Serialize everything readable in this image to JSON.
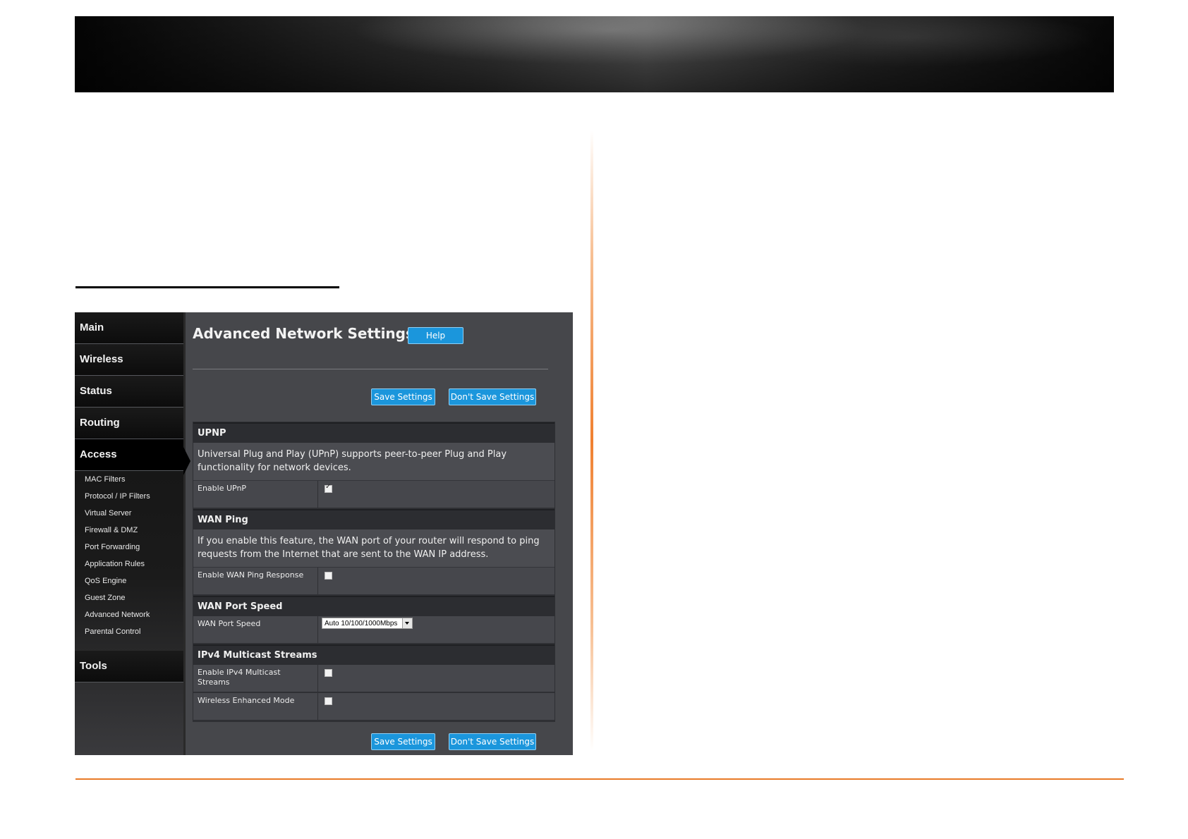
{
  "router_ui": {
    "sidebar": {
      "items": [
        {
          "label": "Main"
        },
        {
          "label": "Wireless"
        },
        {
          "label": "Status"
        },
        {
          "label": "Routing"
        },
        {
          "label": "Access"
        },
        {
          "label": "Tools"
        }
      ],
      "access_submenu": [
        "MAC Filters",
        "Protocol / IP Filters",
        "Virtual Server",
        "Firewall & DMZ",
        "Port Forwarding",
        "Application Rules",
        "QoS Engine",
        "Guest Zone",
        "Advanced Network",
        "Parental Control"
      ],
      "active_item": "Access"
    },
    "page_title": "Advanced Network Settings",
    "help_label": "Help",
    "save_label": "Save Settings",
    "dont_save_label": "Don't Save Settings",
    "sections": {
      "upnp": {
        "title": "UPNP",
        "description": "Universal Plug and Play (UPnP) supports peer-to-peer Plug and Play functionality for network devices.",
        "enable_label": "Enable UPnP",
        "enable_checked": true
      },
      "wan_ping": {
        "title": "WAN Ping",
        "description": "If you enable this feature, the WAN port of your router will respond to ping requests from the Internet that are sent to the WAN IP address.",
        "enable_label": "Enable WAN Ping Response",
        "enable_checked": false
      },
      "wan_port_speed": {
        "title": "WAN Port Speed",
        "label": "WAN Port Speed",
        "selected": "Auto 10/100/1000Mbps"
      },
      "ipv4_multicast": {
        "title": "IPv4 Multicast Streams",
        "enable_label": "Enable IPv4 Multicast Streams",
        "enable_checked": false,
        "wireless_label": "Wireless Enhanced Mode",
        "wireless_checked": false
      }
    }
  },
  "colors": {
    "accent_orange": "#e87a26",
    "button_blue": "#1b96dc",
    "ui_background": "#46474b"
  }
}
